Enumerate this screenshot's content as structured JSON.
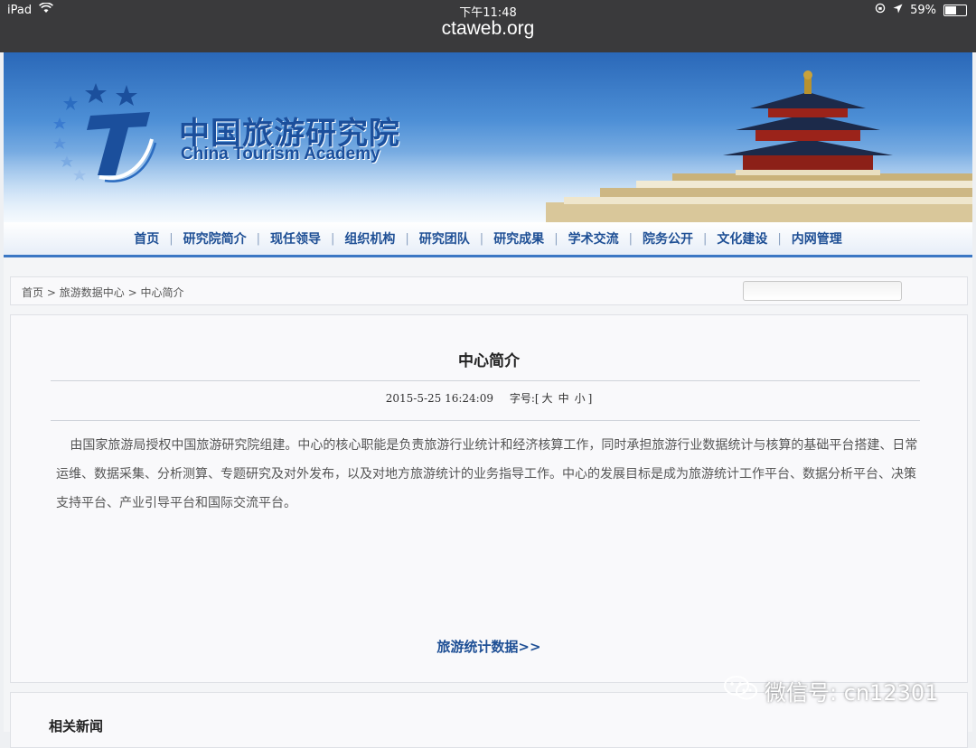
{
  "status_bar": {
    "device": "iPad",
    "time": "下午11:48",
    "battery": "59%",
    "battery_level": 0.59
  },
  "url_bar": {
    "url": "ctaweb.org"
  },
  "header": {
    "brand_cn": "中国旅游研究院",
    "brand_en": "China Tourism Academy"
  },
  "nav": {
    "items": [
      "首页",
      "研究院简介",
      "现任领导",
      "组织机构",
      "研究团队",
      "研究成果",
      "学术交流",
      "院务公开",
      "文化建设",
      "内网管理"
    ]
  },
  "breadcrumb": {
    "home": "首页",
    "section": "旅游数据中心",
    "current": "中心简介",
    "sep": ">"
  },
  "article": {
    "title": "中心简介",
    "date": "2015-5-25 16:24:09",
    "font_size_label": "字号:[",
    "font_large": "大",
    "font_medium": "中",
    "font_small": "小",
    "font_close": "]",
    "body": "由国家旅游局授权中国旅游研究院组建。中心的核心职能是负责旅游行业统计和经济核算工作，同时承担旅游行业数据统计与核算的基础平台搭建、日常运维、数据采集、分析测算、专题研究及对外发布，以及对地方旅游统计的业务指导工作。中心的发展目标是成为旅游统计工作平台、数据分析平台、决策支持平台、产业引导平台和国际交流平台。",
    "more_link": "旅游统计数据>>"
  },
  "related": {
    "title": "相关新闻"
  },
  "watermark": {
    "text": "微信号: cn12301"
  },
  "colors": {
    "nav_text": "#1e4f95",
    "banner_top": "#2a68b8"
  }
}
